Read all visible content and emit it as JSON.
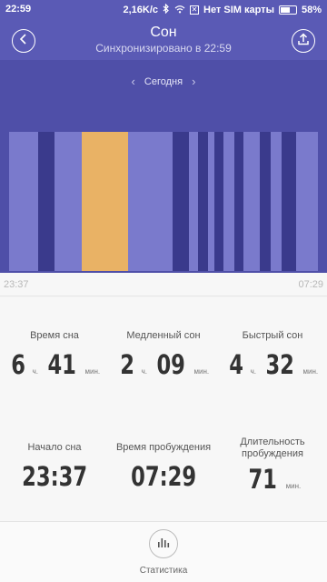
{
  "status": {
    "time": "22:59",
    "speed": "2,16K/c",
    "sim": "Нет SIM карты",
    "battery": "58%",
    "battery_level": 0.58
  },
  "header": {
    "title": "Сон",
    "subtitle": "Синхронизировано в 22:59",
    "back_icon": "chevron-left-icon",
    "share_icon": "upload-icon"
  },
  "date": {
    "label": "Сегодня"
  },
  "chart_data": {
    "type": "bar",
    "legend_colors": {
      "deep": "#3a3a8c",
      "light": "#7a7acc",
      "awake": "#e9b265"
    },
    "segments": [
      {
        "stage": "light",
        "start": 0.0,
        "end": 0.094
      },
      {
        "stage": "deep",
        "start": 0.094,
        "end": 0.147
      },
      {
        "stage": "light",
        "start": 0.147,
        "end": 0.235
      },
      {
        "stage": "awake",
        "start": 0.235,
        "end": 0.385
      },
      {
        "stage": "light",
        "start": 0.385,
        "end": 0.529
      },
      {
        "stage": "deep",
        "start": 0.529,
        "end": 0.582
      },
      {
        "stage": "light",
        "start": 0.582,
        "end": 0.612
      },
      {
        "stage": "deep",
        "start": 0.612,
        "end": 0.644
      },
      {
        "stage": "light",
        "start": 0.644,
        "end": 0.665
      },
      {
        "stage": "deep",
        "start": 0.665,
        "end": 0.694
      },
      {
        "stage": "light",
        "start": 0.694,
        "end": 0.729
      },
      {
        "stage": "deep",
        "start": 0.729,
        "end": 0.759
      },
      {
        "stage": "light",
        "start": 0.759,
        "end": 0.812
      },
      {
        "stage": "deep",
        "start": 0.812,
        "end": 0.846
      },
      {
        "stage": "light",
        "start": 0.846,
        "end": 0.882
      },
      {
        "stage": "deep",
        "start": 0.882,
        "end": 0.929
      },
      {
        "stage": "light",
        "start": 0.929,
        "end": 1.0
      }
    ],
    "x_start": "23:37",
    "x_end": "07:29"
  },
  "stats": {
    "sleep_time": {
      "label": "Время сна",
      "hours": "6",
      "h_unit": "ч.",
      "minutes": "41",
      "m_unit": "мин."
    },
    "deep_sleep": {
      "label": "Медленный сон",
      "hours": "2",
      "h_unit": "ч.",
      "minutes": "09",
      "m_unit": "мин."
    },
    "rem_sleep": {
      "label": "Быстрый сон",
      "hours": "4",
      "h_unit": "ч.",
      "minutes": "32",
      "m_unit": "мин."
    },
    "sleep_start": {
      "label": "Начало сна",
      "value": "23:37"
    },
    "wake_time": {
      "label": "Время пробуждения",
      "value": "07:29"
    },
    "awake_duration": {
      "label_line1": "Длительность",
      "label_line2": "пробуждения",
      "value": "71",
      "unit": "мин."
    }
  },
  "bottom": {
    "statistics_label": "Статистика",
    "statistics_icon": "bar-chart-icon"
  }
}
